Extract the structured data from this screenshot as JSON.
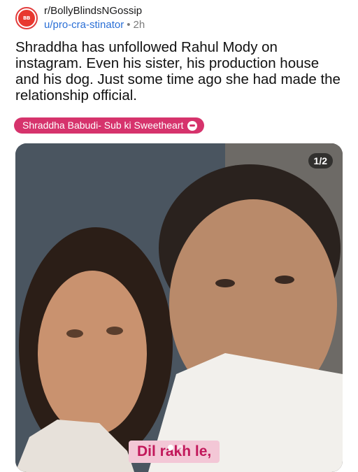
{
  "post": {
    "subreddit": "r/BollyBlindsNGossip",
    "author": "u/pro-cra-stinator",
    "separator": "•",
    "time": "2h",
    "title": "Shraddha has unfollowed Rahul Mody on instagram. Even his sister, his production house and his dog. Just some time ago she had made the relationship official.",
    "flair": "Shraddha Babudi- Sub ki Sweetheart"
  },
  "media": {
    "counter": "1/2",
    "caption": "Dil rakh le,",
    "image_description_icon": "photo-of-two-people-selfie",
    "dots": {
      "count": 2,
      "active": 0
    }
  },
  "colors": {
    "flair_bg": "#d6336c",
    "author_link": "#2a6fd6",
    "avatar_ring": "#e23d3d"
  }
}
